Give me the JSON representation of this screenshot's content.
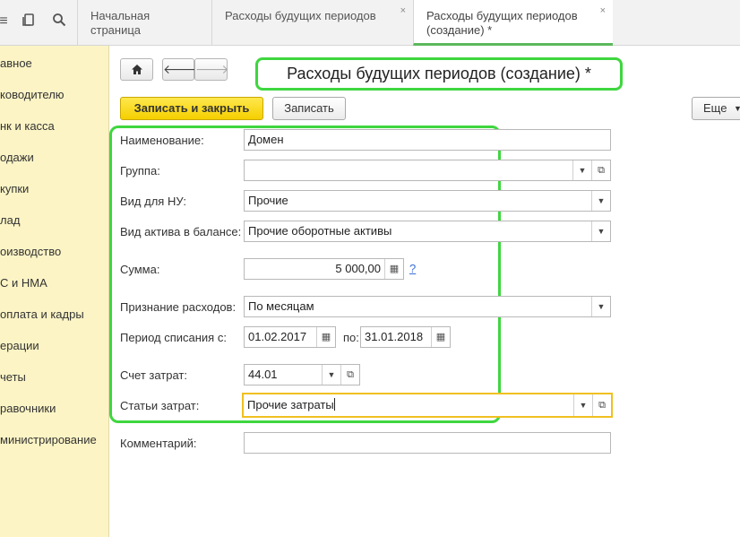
{
  "toolbar_icons": [
    "menu-grid-icon",
    "history-icon",
    "search-icon"
  ],
  "tabs": [
    {
      "label": "Начальная страница"
    },
    {
      "label": "Расходы будущих периодов"
    },
    {
      "label_line1": "Расходы будущих периодов",
      "label_line2": "(создание) *"
    }
  ],
  "tab_close_glyph": "×",
  "sidebar": {
    "items": [
      "авное",
      "ководителю",
      "нк и касса",
      "одажи",
      "купки",
      "лад",
      "оизводство",
      "С и НМА",
      "оплата и кадры",
      "ерации",
      "четы",
      "равочники",
      "министрирование"
    ]
  },
  "form": {
    "title": "Расходы будущих периодов (создание) *",
    "save_close_label": "Записать и закрыть",
    "save_label": "Записать",
    "more_label": "Еще",
    "fields": {
      "name": {
        "label": "Наименование:",
        "value": "Домен"
      },
      "group": {
        "label": "Группа:",
        "value": ""
      },
      "nu_type": {
        "label": "Вид для НУ:",
        "value": "Прочие"
      },
      "asset_type": {
        "label": "Вид актива в балансе:",
        "value": "Прочие оборотные активы"
      },
      "amount": {
        "label": "Сумма:",
        "value": "5 000,00",
        "help": "?"
      },
      "recognition": {
        "label": "Признание расходов:",
        "value": "По месяцам"
      },
      "period": {
        "label": "Период списания с:",
        "from": "01.02.2017",
        "to_label": "по:",
        "to": "31.01.2018"
      },
      "account": {
        "label": "Счет затрат:",
        "value": "44.01"
      },
      "cost_items": {
        "label": "Статьи затрат:",
        "value": "Прочие затраты"
      },
      "comment": {
        "label": "Комментарий:",
        "value": ""
      }
    }
  },
  "accent_colors": {
    "highlight_frame": "#3fd63f",
    "primary_button": "#f5cf00",
    "sidebar_bg": "#fcf4c5"
  }
}
